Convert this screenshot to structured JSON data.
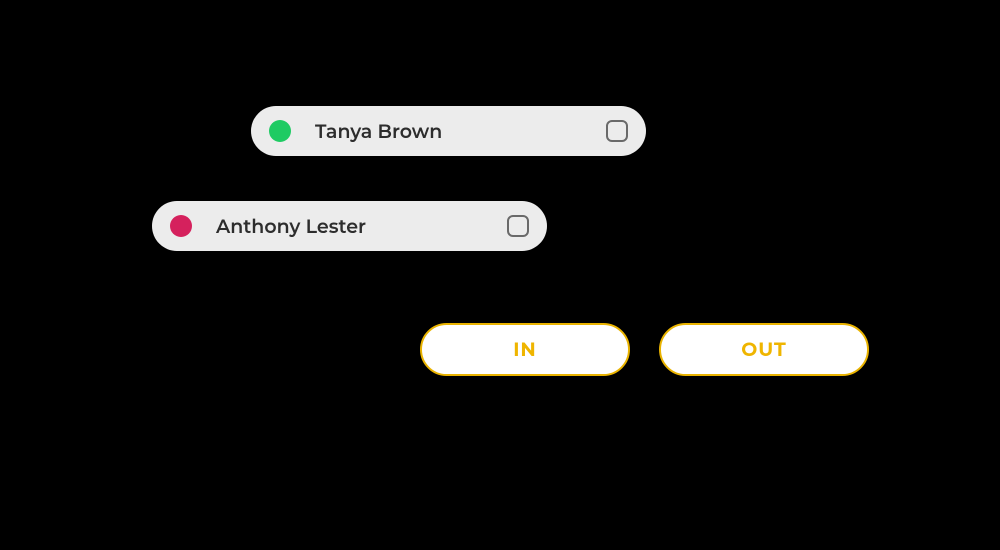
{
  "people": [
    {
      "name": "Tanya Brown",
      "status_color": "#1ecb63",
      "checked": false
    },
    {
      "name": "Anthony Lester",
      "status_color": "#d5215d",
      "checked": false
    }
  ],
  "buttons": {
    "in_label": "IN",
    "out_label": "OUT",
    "accent_color": "#efb500"
  }
}
